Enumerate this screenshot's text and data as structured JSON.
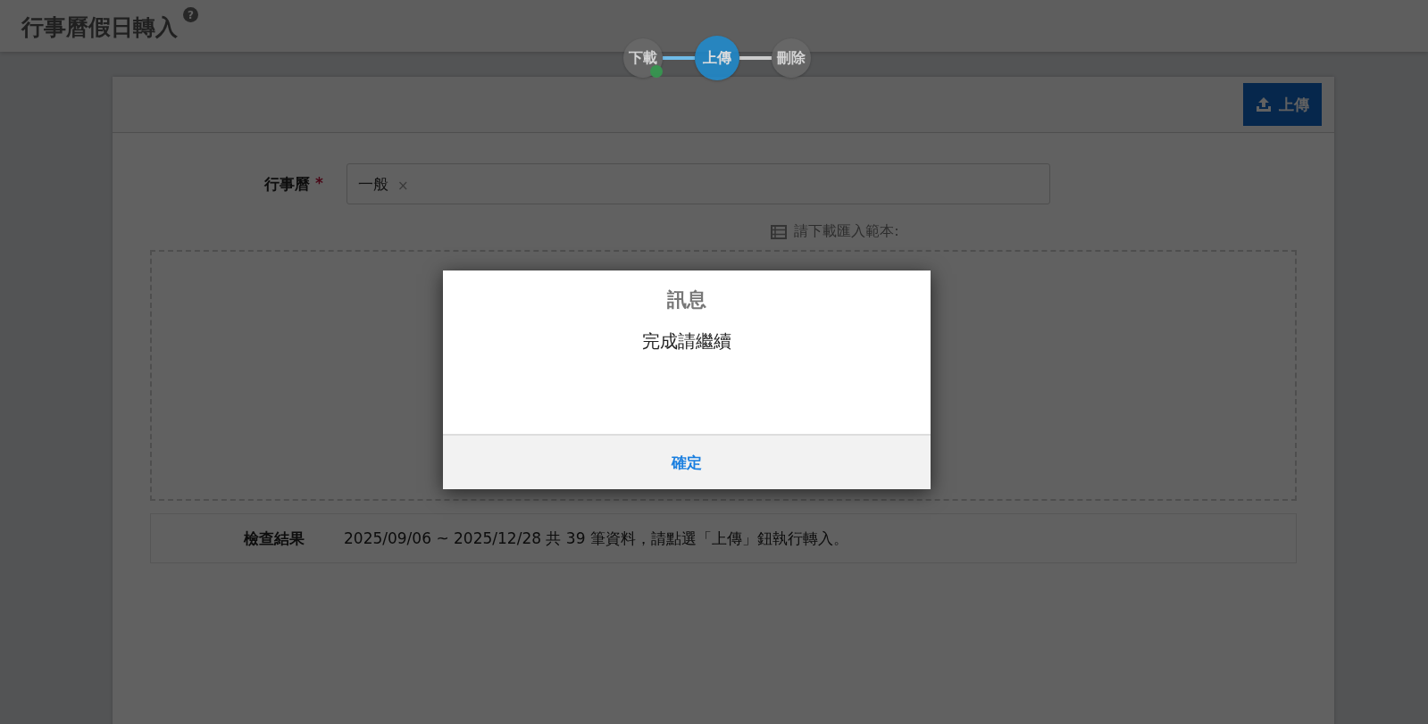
{
  "page": {
    "title": "行事曆假日轉入",
    "help_icon": "?"
  },
  "steps": [
    {
      "label": "下載",
      "done": true,
      "selected": false
    },
    {
      "label": "上傳",
      "done": false,
      "selected": true
    },
    {
      "label": "刪除",
      "done": false,
      "selected": false
    }
  ],
  "toolbar": {
    "upload_button": "上傳"
  },
  "form": {
    "calendar_label": "行事曆",
    "required_mark": "*",
    "tags": [
      {
        "label": "一般",
        "remove": "×"
      }
    ],
    "template_hint": "請下載匯入範本:"
  },
  "check_result": {
    "label": "檢查結果",
    "text": "2025/09/06 ~ 2025/12/28 共 39 筆資料，請點選「上傳」鈕執行轉入。"
  },
  "dialog": {
    "title": "訊息",
    "message": "完成請繼續",
    "confirm_button": "確定"
  }
}
